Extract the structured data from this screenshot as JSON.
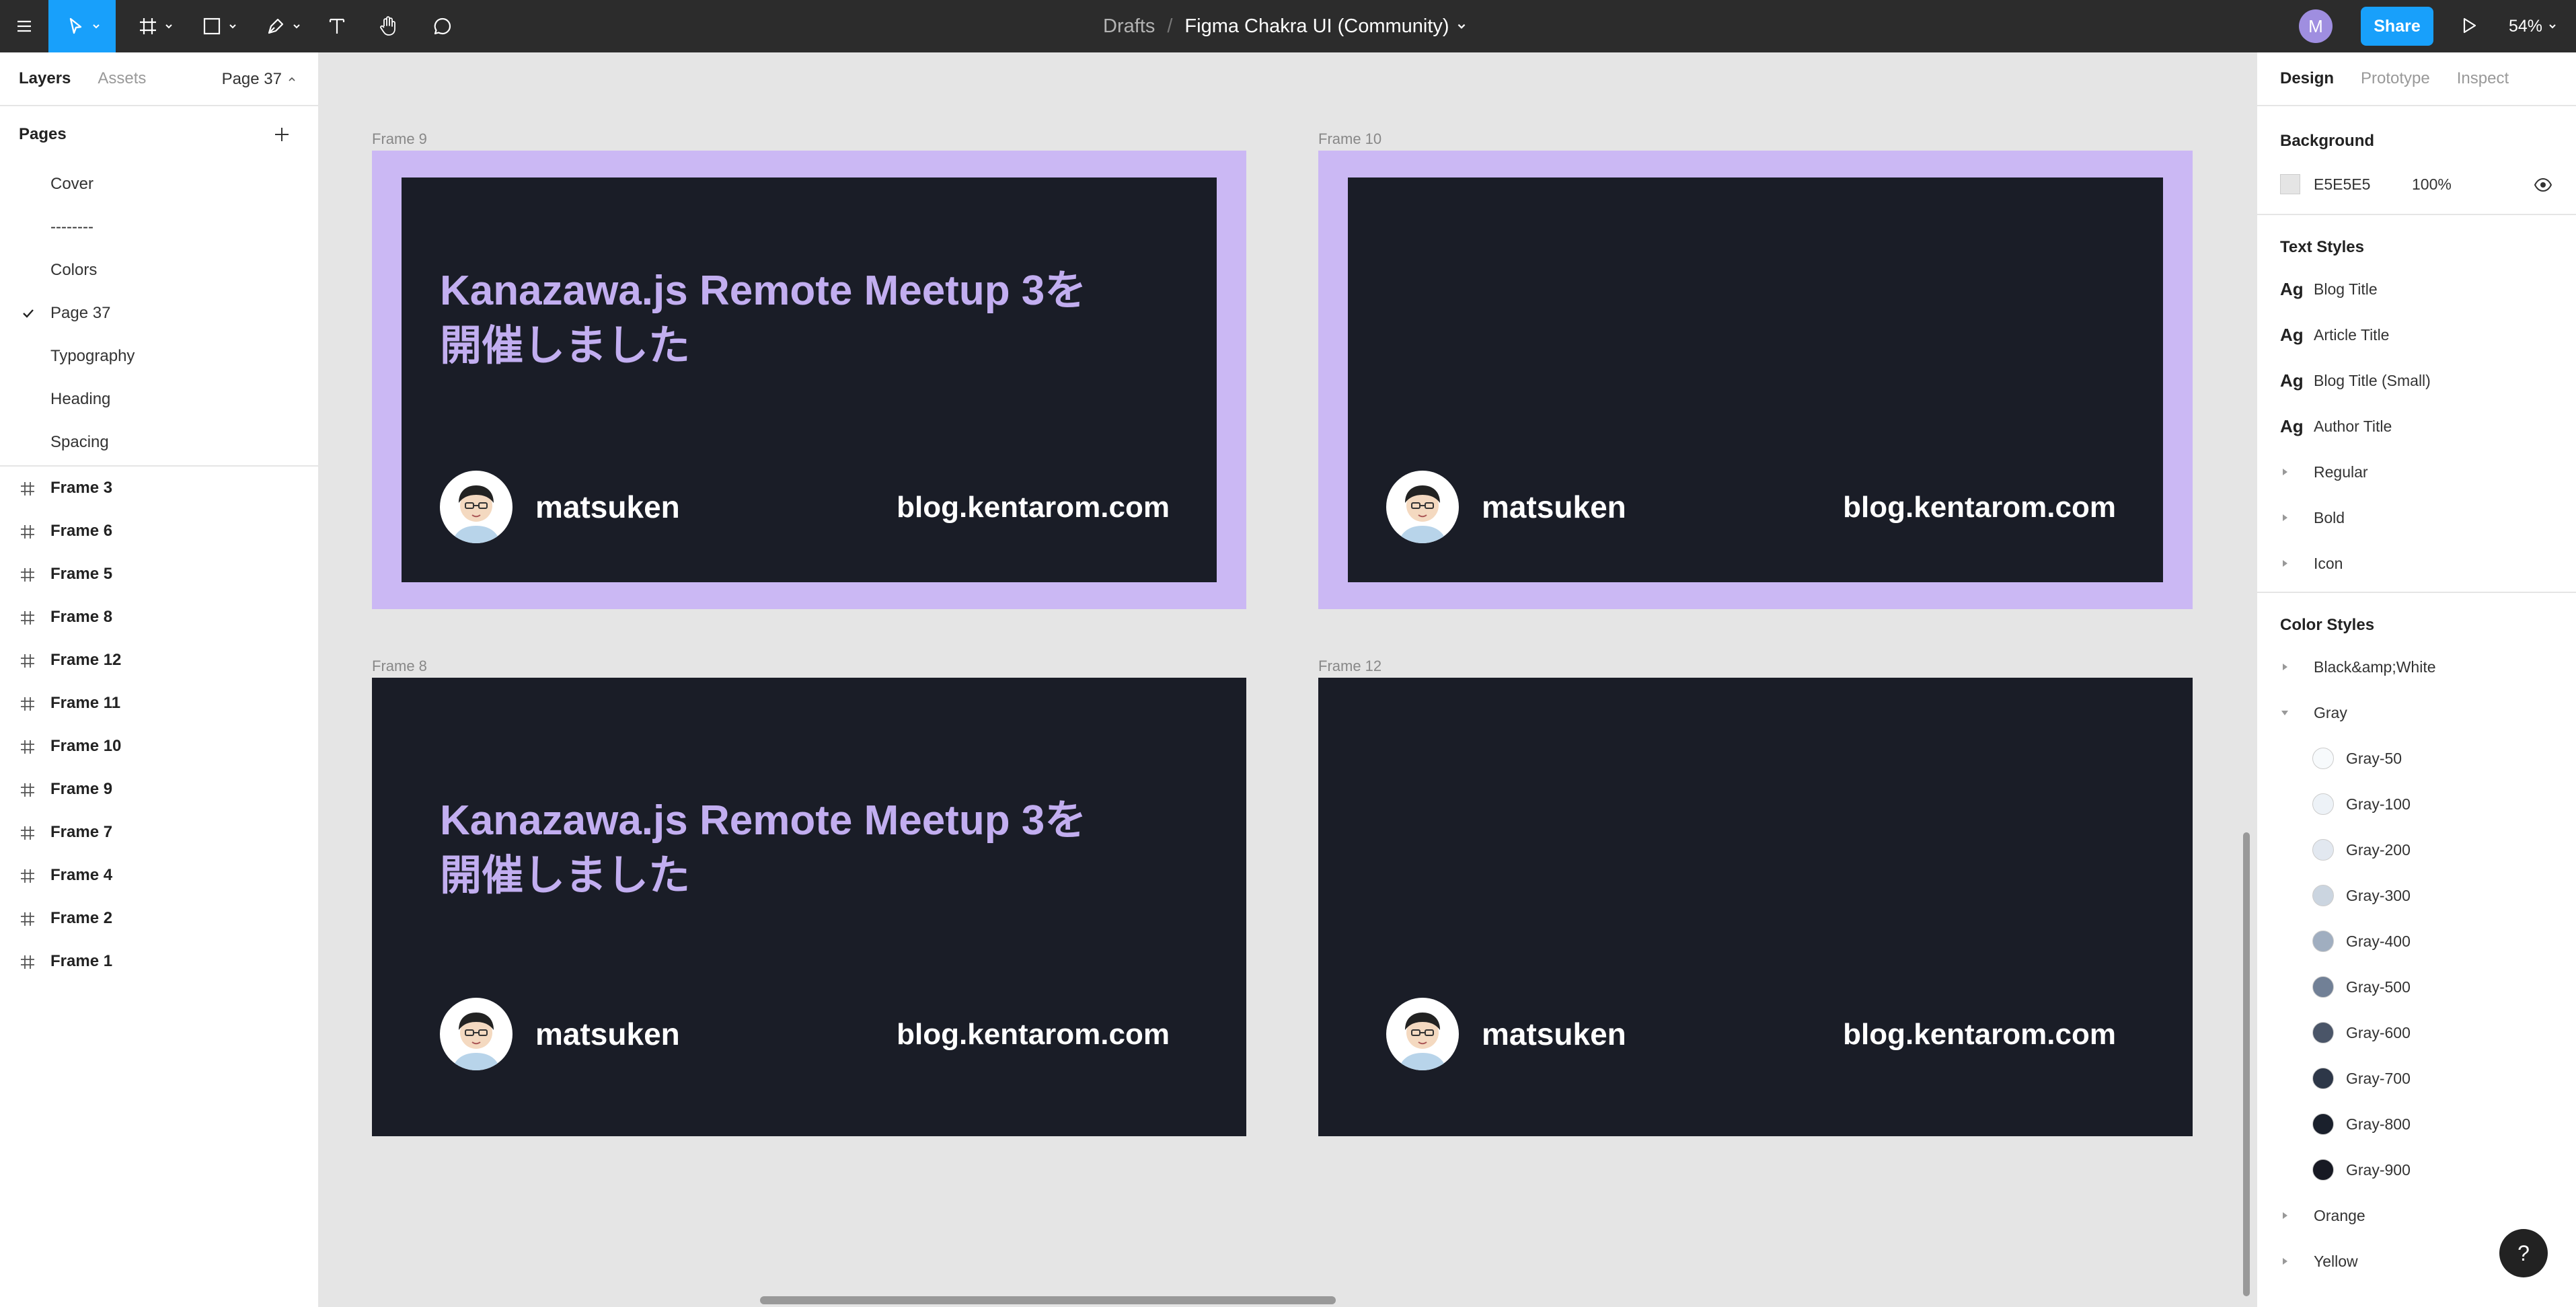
{
  "topbar": {
    "breadcrumb_drafts": "Drafts",
    "breadcrumb_sep": "/",
    "file_name": "Figma Chakra UI (Community)",
    "avatar_letter": "M",
    "share_label": "Share",
    "zoom": "54%"
  },
  "left_panel": {
    "tabs": [
      "Layers",
      "Assets"
    ],
    "current_page": "Page 37",
    "pages_title": "Pages",
    "pages": [
      "Cover",
      "--------",
      "Colors",
      "Page 37",
      "Typography",
      "Heading",
      "Spacing"
    ],
    "selected_page": "Page 37",
    "layers": [
      "Frame 3",
      "Frame 6",
      "Frame 5",
      "Frame 8",
      "Frame 12",
      "Frame 11",
      "Frame 10",
      "Frame 9",
      "Frame 7",
      "Frame 4",
      "Frame 2",
      "Frame 1"
    ]
  },
  "canvas": {
    "frames": [
      {
        "label": "Frame 9",
        "title": "Kanazawa.js Remote Meetup 3を\n開催しました",
        "author": "matsuken",
        "url": "blog.kentarom.com"
      },
      {
        "label": "Frame 10",
        "title": "",
        "author": "matsuken",
        "url": "blog.kentarom.com"
      },
      {
        "label": "Frame 8",
        "title": "Kanazawa.js Remote Meetup 3を\n開催しました",
        "author": "matsuken",
        "url": "blog.kentarom.com"
      },
      {
        "label": "Frame 12",
        "title": "",
        "author": "matsuken",
        "url": "blog.kentarom.com"
      }
    ]
  },
  "right_panel": {
    "tabs": [
      "Design",
      "Prototype",
      "Inspect"
    ],
    "background_title": "Background",
    "background_hex": "E5E5E5",
    "background_opacity": "100%",
    "text_styles_title": "Text Styles",
    "text_styles": [
      "Blog Title",
      "Article Title",
      "Blog Title (Small)",
      "Author Title"
    ],
    "text_groups": [
      "Regular",
      "Bold",
      "Icon"
    ],
    "color_styles_title": "Color Styles",
    "color_group_1": "Black&amp;White",
    "color_group_2": "Gray",
    "gray_colors": [
      {
        "name": "Gray-50",
        "color": "#F7FAFC"
      },
      {
        "name": "Gray-100",
        "color": "#EDF2F7"
      },
      {
        "name": "Gray-200",
        "color": "#E2E8F0"
      },
      {
        "name": "Gray-300",
        "color": "#CBD5E0"
      },
      {
        "name": "Gray-400",
        "color": "#A0AEC0"
      },
      {
        "name": "Gray-500",
        "color": "#718096"
      },
      {
        "name": "Gray-600",
        "color": "#4A5568"
      },
      {
        "name": "Gray-700",
        "color": "#2D3748"
      },
      {
        "name": "Gray-800",
        "color": "#1A202C"
      },
      {
        "name": "Gray-900",
        "color": "#171923"
      }
    ],
    "color_group_3": "Orange",
    "color_group_4": "Yellow",
    "help_label": "?"
  },
  "colors": {
    "accent": "#18A0FB",
    "frame_purple": "#CBB8F4",
    "card_dark": "#1A1D27",
    "title_purple": "#C2AEF0"
  }
}
